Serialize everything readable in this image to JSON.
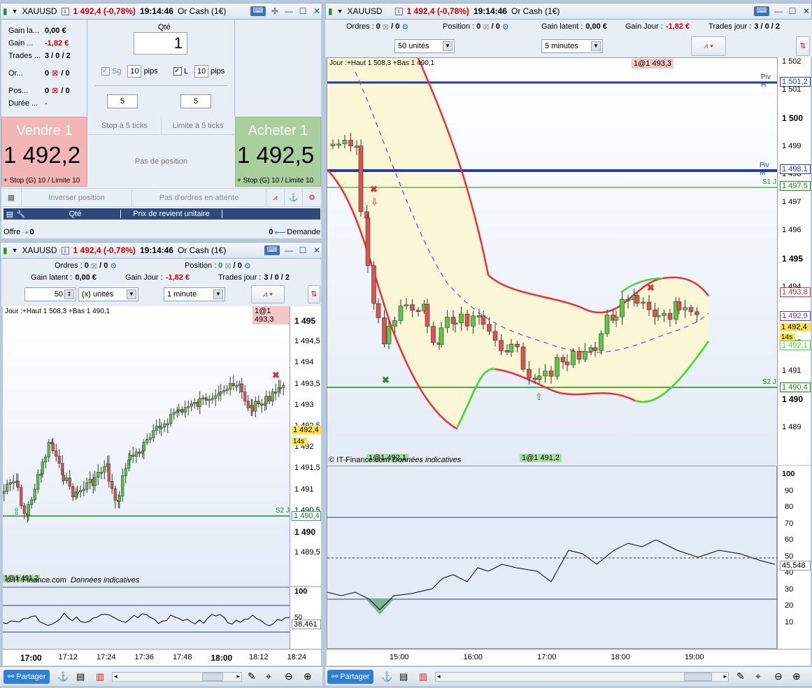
{
  "topwin": {
    "symbol": "XAUUSD",
    "price_change": "1 492,4 (-0,78%)",
    "time": "19:14:46",
    "account": "Or Cash (1€)",
    "stats": [
      {
        "label": "Gain la...",
        "value": "0,00 €",
        "color": "#000"
      },
      {
        "label": "Gain ...",
        "value": "-1,82 €",
        "color": "#c00"
      },
      {
        "label": "Trades ...",
        "value": "3 / 0 / 2",
        "color": "#000"
      },
      {
        "label": "Or...",
        "value": "0",
        "value2": "/ 0",
        "color": "#000"
      },
      {
        "label": "Pos...",
        "value": "0",
        "value2": "/ 0",
        "color": "#000"
      },
      {
        "label": "Durée ...",
        "value": "-",
        "color": "#000"
      }
    ],
    "qty_label": "Qté",
    "qty_value": "1",
    "sg_label": "Sg",
    "sg_value": "10",
    "pips": "pips",
    "l_label": "L",
    "l_value": "10",
    "stepper_left": "5",
    "stepper_right": "5",
    "sell_label": "Vendre 1",
    "sell_price": "1 492,2",
    "sell_stop": "+ Stop (G) 10 / Limite 10",
    "buy_label": "Acheter 1",
    "buy_price": "1 492,5",
    "buy_stop": "+ Stop (G) 10 / Limite 10",
    "stop_ticks": "Stop à 5 ticks",
    "limit_ticks": "Limite à 5 ticks",
    "no_position": "Pas de position",
    "invert": "Inverser position",
    "no_orders": "Pas d'ordres en attente",
    "col_qty": "Qté",
    "col_price": "Prix de revient unitaire",
    "offer": "Offre",
    "offer_val": "0",
    "demand": "Demande",
    "demand_val": "0"
  },
  "leftchart": {
    "symbol": "XAUUSD",
    "price_change": "1 492,4 (-0,78%)",
    "time": "19:14:46",
    "account": "Or Cash (1€)",
    "orders_label": "Ordres :",
    "orders_val": "0",
    "orders_val2": "/ 0",
    "position_label": "Position :",
    "position_val": "0",
    "position_val2": "/ 0",
    "gain_latent_label": "Gain latent :",
    "gain_latent": "0,00 €",
    "gain_jour_label": "Gain Jour :",
    "gain_jour": "-1,82 €",
    "trades_label": "Trades jour :",
    "trades": "3 / 0 / 2",
    "units_value": "50",
    "units_select": "(x) unités",
    "period_select": "1 minute",
    "info": "Jour :+Haut 1 508,3 +Bas 1 490,1",
    "order_tag": "1@1 493,3",
    "price_labels": [
      "1 495",
      "1 494,5",
      "1 494",
      "1 493,5",
      "1 493",
      "1 492,5",
      "1 492",
      "1 491,5",
      "1 491",
      "1 490,5",
      "1 490",
      "1 489,5"
    ],
    "current_price": "1 492,4",
    "countdown": "14s",
    "s2_label": "S2 J",
    "s2_price": "1 490,4",
    "bottom_tag": "1@1 491,2",
    "copyright": "© IT-Finance.com",
    "indicative": "Données indicatives",
    "osc_labels": [
      "100",
      "50"
    ],
    "osc_value": "38,461",
    "time_labels": [
      "17:00",
      "17:12",
      "17:24",
      "17:36",
      "17:48",
      "18:00",
      "18:12",
      "18:24"
    ]
  },
  "rightchart": {
    "symbol": "XAUUSD",
    "price_change": "1 492,4 (-0,78%)",
    "time": "19:14:46",
    "account": "Or Cash (1€)",
    "orders_label": "Ordres :",
    "orders_val": "0",
    "orders_val2": "/ 0",
    "position_label": "Position :",
    "position_val": "0",
    "position_val2": "/ 0",
    "gain_latent_label": "Gain latent :",
    "gain_latent": "0,00 €",
    "gain_jour_label": "Gain Jour :",
    "gain_jour": "-1,82 €",
    "trades_label": "Trades jour :",
    "trades": "3 / 0 / 2",
    "units_select": "50 unités",
    "period_select": "5 minutes",
    "info": "Jour :+Haut 1 508,3 +Bas 1 490,1",
    "order_tag_top": "1@1 493,3",
    "piv_h": "Piv H",
    "piv_h_price": "1 501,2",
    "piv_m": "Piv M",
    "piv_m_price": "1 498,1",
    "s1": "S1 J",
    "s1_price": "1 497,5",
    "s2": "S2 J",
    "s2_price": "1 490,4",
    "price_labels": [
      "1 502",
      "1 501",
      "1 500",
      "1 499",
      "1 498",
      "1 497",
      "1 496",
      "1 495",
      "1 494",
      "1 493",
      "1 492",
      "1 491",
      "1 490",
      "1 489"
    ],
    "marker_price_1": "1 493,8",
    "marker_price_2": "1 492,9",
    "current_price": "1 492,4",
    "countdown": "14s",
    "marker_price_3": "1 492,1",
    "bottom_tag_1": "1@1 492,1",
    "bottom_tag_2": "1@1 491,2",
    "copyright": "© IT-Finance.com",
    "indicative": "Données indicatives",
    "osc_labels": [
      "100",
      "90",
      "80",
      "70",
      "60",
      "50",
      "40",
      "30",
      "20",
      "10"
    ],
    "osc_value": "45,548",
    "time_labels": [
      "15:00",
      "16:00",
      "17:00",
      "18:00",
      "19:00"
    ]
  },
  "bottom": {
    "share_label": "Partager"
  },
  "colors": {
    "sell_bg": "#f2b6b6",
    "buy_bg": "#a9cf9d",
    "accent": "#1f3fa6",
    "red": "#c00",
    "green": "#1a8c1a"
  }
}
